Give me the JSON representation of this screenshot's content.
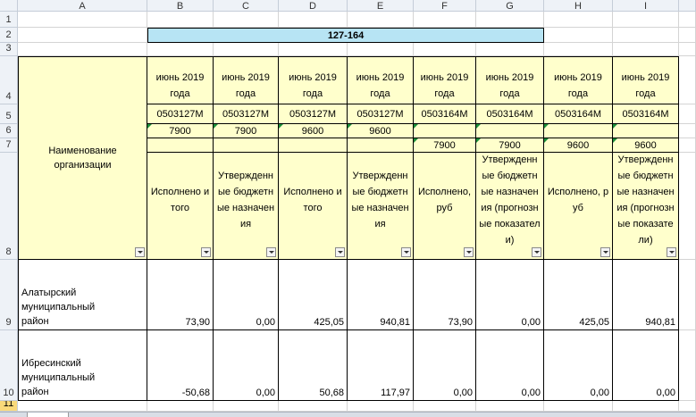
{
  "columns": [
    "A",
    "B",
    "C",
    "D",
    "E",
    "F",
    "G",
    "H",
    "I"
  ],
  "rows": [
    "1",
    "2",
    "3",
    "4",
    "5",
    "6",
    "7",
    "8",
    "9",
    "10",
    "11"
  ],
  "title": "127-164",
  "row4": [
    "июнь 2019 года",
    "июнь 2019 года",
    "июнь 2019 года",
    "июнь 2019 года",
    "июнь 2019 года",
    "июнь 2019 года",
    "июнь 2019 года",
    "июнь 2019 года"
  ],
  "row5": [
    "0503127М",
    "0503127М",
    "0503127М",
    "0503127М",
    "0503164М",
    "0503164М",
    "0503164М",
    "0503164М"
  ],
  "row6": [
    "7900",
    "7900",
    "9600",
    "9600",
    "",
    "",
    "",
    ""
  ],
  "row7": [
    "",
    "",
    "",
    "",
    "7900",
    "7900",
    "9600",
    "9600"
  ],
  "name_header": "Наименование организации",
  "row8": [
    "Исполнено итого",
    "Утвержденные бюджетные назначения",
    "Исполнено итого",
    "Утвержденные бюджетные назначения",
    "Исполнено, руб",
    "Утвержденные бюджетные назначения (прогнозные показатели)",
    "Исполнено, руб",
    "Утвержденные бюджетные назначения (прогнозные показатели)"
  ],
  "data": [
    {
      "name": "Алатырский муниципальный район",
      "values": [
        "73,90",
        "0,00",
        "425,05",
        "940,81",
        "73,90",
        "0,00",
        "425,05",
        "940,81"
      ]
    },
    {
      "name": "Ибресинский муниципальный район",
      "values": [
        "-50,68",
        "0,00",
        "50,68",
        "117,97",
        "0,00",
        "0,00",
        "0,00",
        "0,00"
      ]
    }
  ]
}
